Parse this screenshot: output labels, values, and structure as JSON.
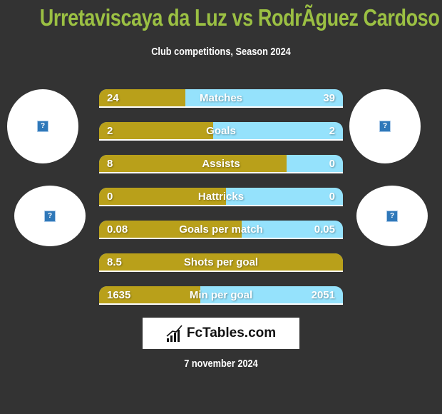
{
  "header": {
    "title": "Urretaviscaya da Luz vs RodrÃguez Cardoso",
    "subtitle": "Club competitions, Season 2024"
  },
  "players": {
    "left": {
      "photo_icon": "missing-image-icon",
      "club_icon": "missing-image-icon"
    },
    "right": {
      "photo_icon": "missing-image-icon",
      "club_icon": "missing-image-icon"
    }
  },
  "colors": {
    "background": "#333333",
    "title": "#9bc043",
    "left_bar": "#b9a01a",
    "right_bar": "#95e2fc"
  },
  "stats": [
    {
      "label": "Matches",
      "left": "24",
      "right": "39",
      "left_fraction": 0.354
    },
    {
      "label": "Goals",
      "left": "2",
      "right": "2",
      "left_fraction": 0.468
    },
    {
      "label": "Assists",
      "left": "8",
      "right": "0",
      "left_fraction": 0.769
    },
    {
      "label": "Hattricks",
      "left": "0",
      "right": "0",
      "left_fraction": 0.52
    },
    {
      "label": "Goals per match",
      "left": "0.08",
      "right": "0.05",
      "left_fraction": 0.585
    },
    {
      "label": "Shots per goal",
      "left": "8.5",
      "right": "",
      "left_fraction": 1.0
    },
    {
      "label": "Min per goal",
      "left": "1635",
      "right": "2051",
      "left_fraction": 0.415
    }
  ],
  "logo": {
    "text": "FcTables.com",
    "icon": "bar-chart-icon"
  },
  "footer": {
    "date": "7 november 2024"
  }
}
